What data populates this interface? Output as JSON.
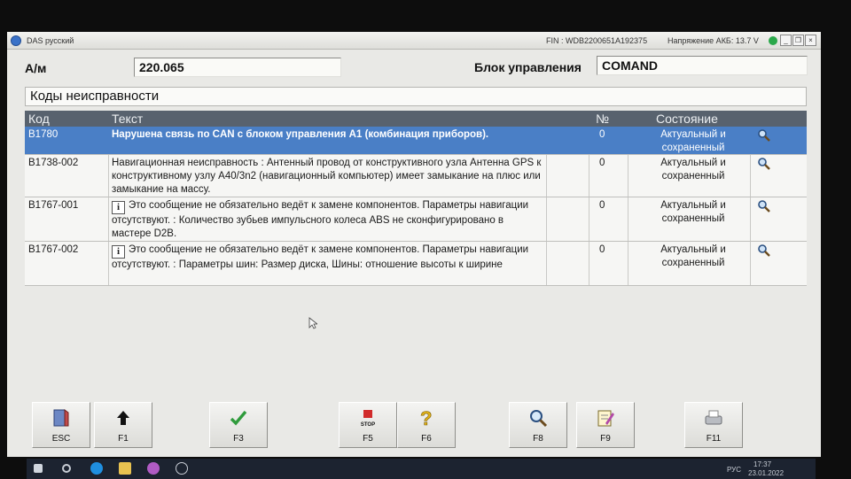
{
  "window": {
    "title": "DAS русский",
    "fin": "FIN : WDB2200651A192375",
    "voltage": "Напряжение АКБ: 13.7 V",
    "status_color": "#2aa84a"
  },
  "header": {
    "vehicle_label": "А/м",
    "vehicle_value": "220.065",
    "control_unit_label": "Блок управления",
    "control_unit_value": "COMAND"
  },
  "section_title": "Коды неисправности",
  "table": {
    "columns": {
      "code": "Код",
      "text": "Текст",
      "num": "№",
      "state": "Состояние"
    },
    "rows": [
      {
        "code": "B1780",
        "text": "Нарушена связь по CAN с блоком управления A1 (комбинация приборов).",
        "num": "0",
        "state": "Актуальный и сохраненный",
        "selected": true,
        "info": false
      },
      {
        "code": "B1738-002",
        "text": "Навигационная неисправность : Антенный провод от конструктивного узла Антенна GPS к конструктивному узлу A40/3n2 (навигационный компьютер) имеет замыкание на плюс или замыкание на массу.",
        "num": "0",
        "state": "Актуальный и сохраненный",
        "selected": false,
        "info": false
      },
      {
        "code": "B1767-001",
        "text": "Это сообщение не обязательно ведёт к замене компонентов. Параметры навигации отсутствуют. : Количество зубьев импульсного колеса ABS не сконфигурировано в мастере D2B.",
        "num": "0",
        "state": "Актуальный и сохраненный",
        "selected": false,
        "info": true
      },
      {
        "code": "B1767-002",
        "text": "Это сообщение не обязательно ведёт к замене компонентов. Параметры навигации отсутствуют. : Параметры шин: Размер диска, Шины: отношение высоты к ширине",
        "num": "0",
        "state": "Актуальный и сохраненный",
        "selected": false,
        "info": true
      }
    ],
    "info_icon_glyph": "i",
    "selected_color": "#4a7fc6",
    "header_color": "#58626e"
  },
  "fkeys": [
    {
      "label": "ESC",
      "icon": "exit-door-icon"
    },
    {
      "label": "F1",
      "icon": "arrow-up-icon"
    },
    {
      "label": "F3",
      "icon": "checkmark-icon"
    },
    {
      "label": "F5",
      "icon": "stop-icon",
      "icon_text": "STOP"
    },
    {
      "label": "F6",
      "icon": "help-question-icon"
    },
    {
      "label": "F8",
      "icon": "magnifier-icon"
    },
    {
      "label": "F9",
      "icon": "notepad-edit-icon"
    },
    {
      "label": "F11",
      "icon": "printer-icon"
    }
  ],
  "taskbar": {
    "lang": "РУС",
    "time": "17:37",
    "date": "23.01.2022"
  }
}
